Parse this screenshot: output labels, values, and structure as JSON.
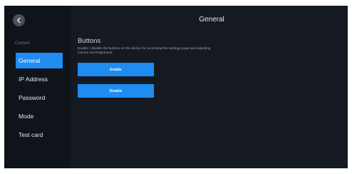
{
  "header": {
    "title": "General"
  },
  "sidebar": {
    "back_icon": "chevron-left-icon",
    "section_label": "Content",
    "items": [
      {
        "label": "General",
        "active": true
      },
      {
        "label": "IP Address",
        "active": false
      },
      {
        "label": "Password",
        "active": false
      },
      {
        "label": "Mode",
        "active": false
      },
      {
        "label": "Test card",
        "active": false
      }
    ]
  },
  "main": {
    "section_title": "Buttons",
    "section_description": "Enable / disable the buttons on the device for accessing the settings page and adjusting volume and brightness.",
    "enable_label": "Enable",
    "disable_label": "Disable"
  },
  "colors": {
    "accent": "#1e8cf0",
    "background": "#151a22",
    "sidebar": "#0f131a"
  }
}
